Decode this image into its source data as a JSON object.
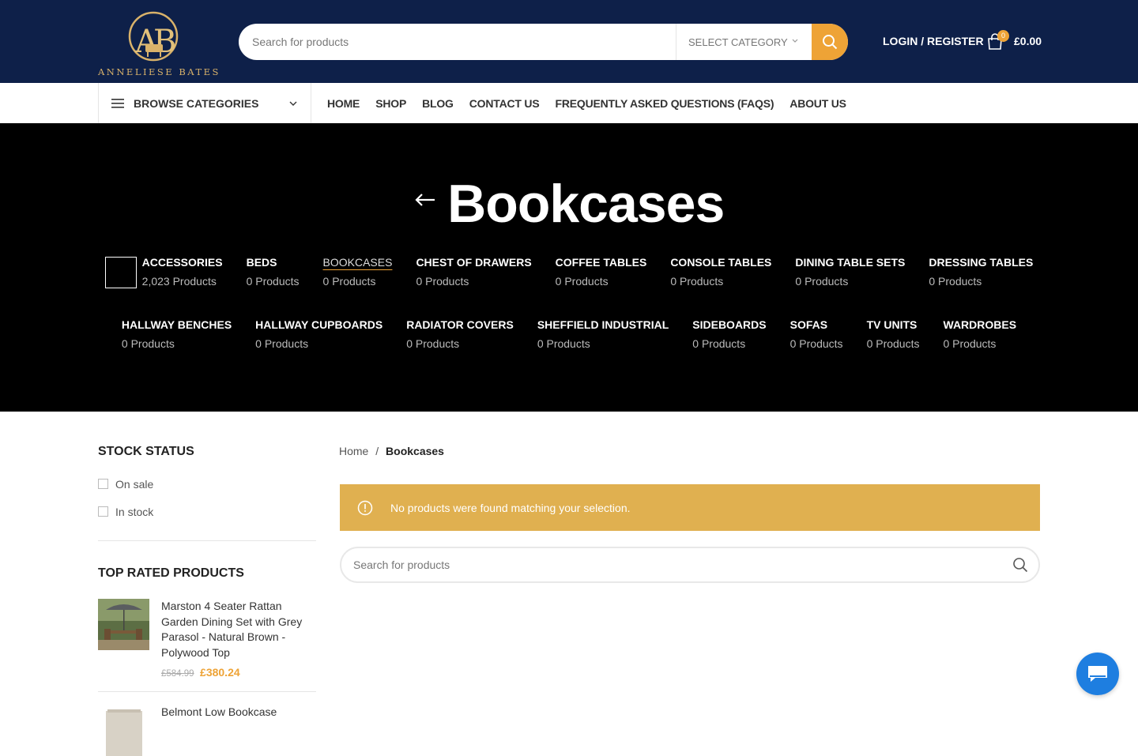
{
  "header": {
    "logo_text": "ANNELIESE BATES",
    "search_placeholder": "Search for products",
    "select_category": "SELECT CATEGORY",
    "login_label": "LOGIN / REGISTER",
    "cart_count": "0",
    "cart_total": "£0.00"
  },
  "nav": {
    "browse_label": "BROWSE CATEGORIES",
    "items": [
      "HOME",
      "SHOP",
      "BLOG",
      "CONTACT US",
      "FREQUENTLY ASKED QUESTIONS (FAQS)",
      "ABOUT US"
    ]
  },
  "hero": {
    "title": "Bookcases",
    "categories_row1": [
      {
        "name": "ACCESSORIES",
        "count": "2,023 Products"
      },
      {
        "name": "BEDS",
        "count": "0 Products"
      },
      {
        "name": "BOOKCASES",
        "count": "0 Products"
      },
      {
        "name": "CHEST OF DRAWERS",
        "count": "0 Products"
      },
      {
        "name": "COFFEE TABLES",
        "count": "0 Products"
      },
      {
        "name": "CONSOLE TABLES",
        "count": "0 Products"
      },
      {
        "name": "DINING TABLE SETS",
        "count": "0 Products"
      },
      {
        "name": "DRESSING TABLES",
        "count": "0 Products"
      }
    ],
    "categories_row2": [
      {
        "name": "HALLWAY BENCHES",
        "count": "0 Products"
      },
      {
        "name": "HALLWAY CUPBOARDS",
        "count": "0 Products"
      },
      {
        "name": "RADIATOR COVERS",
        "count": "0 Products"
      },
      {
        "name": "SHEFFIELD INDUSTRIAL",
        "count": "0 Products"
      },
      {
        "name": "SIDEBOARDS",
        "count": "0 Products"
      },
      {
        "name": "SOFAS",
        "count": "0 Products"
      },
      {
        "name": "TV UNITS",
        "count": "0 Products"
      },
      {
        "name": "WARDROBES",
        "count": "0 Products"
      }
    ]
  },
  "sidebar": {
    "stock_title": "STOCK STATUS",
    "on_sale": "On sale",
    "in_stock": "In stock",
    "top_rated_title": "TOP RATED PRODUCTS",
    "products": [
      {
        "name": "Marston 4 Seater Rattan Garden Dining Set with Grey Parasol - Natural Brown - Polywood Top",
        "old_price": "£584.99",
        "new_price": "£380.24"
      },
      {
        "name": "Belmont Low Bookcase"
      }
    ]
  },
  "main": {
    "breadcrumb_home": "Home",
    "breadcrumb_sep": "/",
    "breadcrumb_current": "Bookcases",
    "notice": "No products were found matching your selection.",
    "search_placeholder": "Search for products"
  },
  "colors": {
    "header_bg": "#0e2049",
    "accent": "#eea336",
    "notice_bg": "#e0b050",
    "chat": "#1e7ee0"
  }
}
